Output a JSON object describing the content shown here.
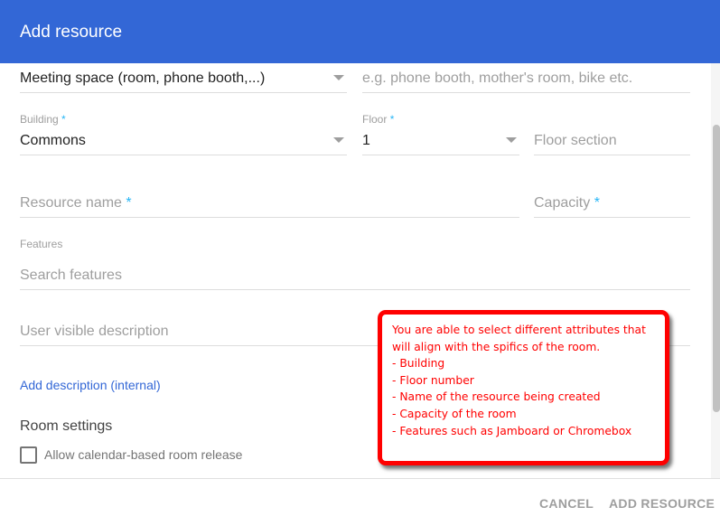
{
  "header": {
    "title": "Add resource"
  },
  "form": {
    "type": {
      "value": "Meeting space (room, phone booth,...)"
    },
    "type_other": {
      "placeholder": "e.g. phone booth, mother's room, bike etc."
    },
    "building": {
      "label": "Building",
      "required": "*",
      "value": "Commons"
    },
    "floor": {
      "label": "Floor",
      "required": "*",
      "value": "1"
    },
    "floor_section": {
      "placeholder": "Floor section"
    },
    "resource_name": {
      "placeholder": "Resource name",
      "required": "*"
    },
    "capacity": {
      "placeholder": "Capacity",
      "required": "*"
    },
    "features": {
      "label": "Features",
      "placeholder": "Search features"
    },
    "description": {
      "placeholder": "User visible description"
    },
    "add_description_link": "Add description (internal)",
    "room_settings": {
      "title": "Room settings",
      "release_label": "Allow calendar-based room release",
      "release_checked": false
    }
  },
  "footer": {
    "cancel": "CANCEL",
    "add": "ADD RESOURCE"
  },
  "callout": {
    "lines": [
      "You are able to select different attributes that",
      "will align with the spifics of the room.",
      "- Building",
      "- Floor number",
      "- Name of the resource being created",
      "- Capacity of the room",
      "- Features such as Jamboard or Chromebox"
    ]
  },
  "colors": {
    "header": "#3367d6",
    "callout": "#ff0000"
  }
}
